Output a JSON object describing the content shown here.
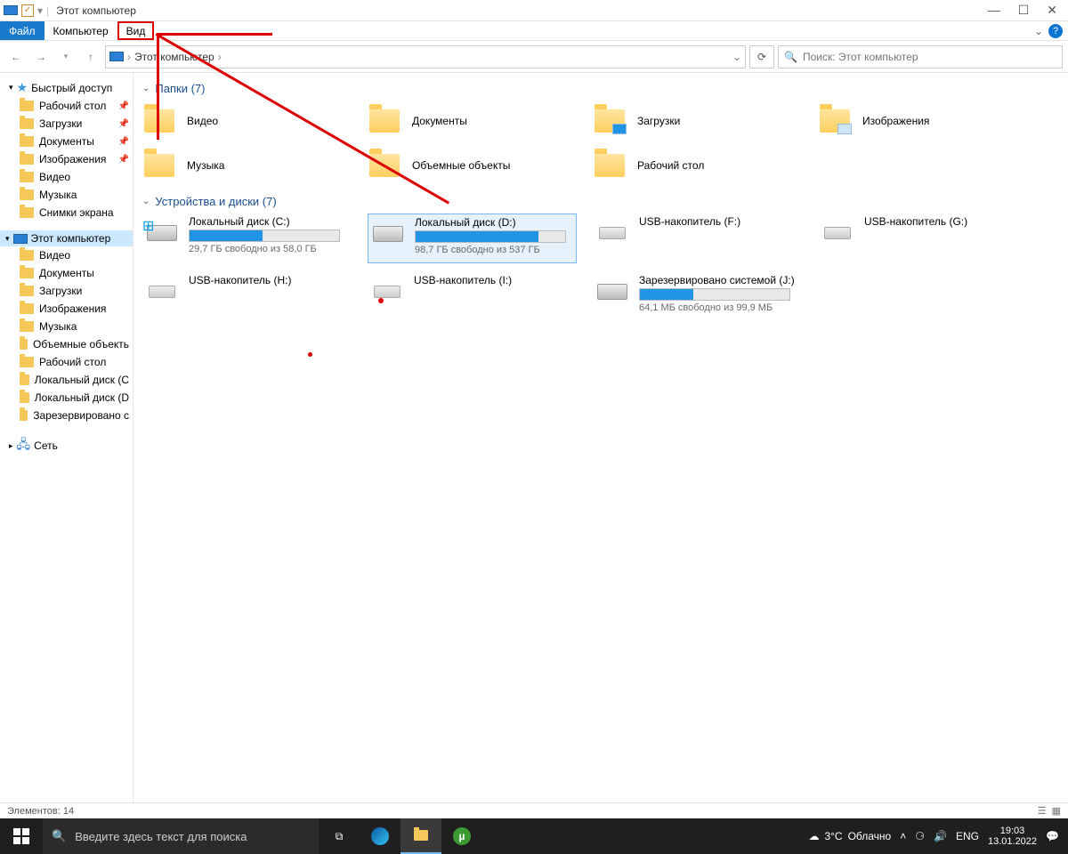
{
  "window": {
    "title": "Этот компьютер"
  },
  "ribbon": {
    "file": "Файл",
    "computer": "Компьютер",
    "view": "Вид"
  },
  "nav": {
    "breadcrumb_root": "Этот компьютер",
    "search_placeholder": "Поиск: Этот компьютер"
  },
  "sidebar": {
    "quick_access": "Быстрый доступ",
    "items_pinned": [
      {
        "label": "Рабочий стол"
      },
      {
        "label": "Загрузки"
      },
      {
        "label": "Документы"
      },
      {
        "label": "Изображения"
      },
      {
        "label": "Видео"
      },
      {
        "label": "Музыка"
      },
      {
        "label": "Снимки экрана"
      }
    ],
    "this_pc": "Этот компьютер",
    "this_pc_children": [
      {
        "label": "Видео"
      },
      {
        "label": "Документы"
      },
      {
        "label": "Загрузки"
      },
      {
        "label": "Изображения"
      },
      {
        "label": "Музыка"
      },
      {
        "label": "Объемные объекть"
      },
      {
        "label": "Рабочий стол"
      },
      {
        "label": "Локальный диск (С"
      },
      {
        "label": "Локальный диск (D"
      },
      {
        "label": "Зарезервировано с"
      }
    ],
    "network": "Сеть"
  },
  "groups": {
    "folders_header": "Папки (7)",
    "drives_header": "Устройства и диски (7)"
  },
  "folders": [
    {
      "label": "Видео"
    },
    {
      "label": "Документы"
    },
    {
      "label": "Загрузки"
    },
    {
      "label": "Изображения"
    },
    {
      "label": "Музыка"
    },
    {
      "label": "Объемные объекты"
    },
    {
      "label": "Рабочий стол"
    }
  ],
  "drives": [
    {
      "label": "Локальный диск (C:)",
      "free": "29,7 ГБ свободно из 58,0 ГБ",
      "fill": 49,
      "type": "hdd",
      "os": true
    },
    {
      "label": "Локальный диск (D:)",
      "free": "98,7 ГБ свободно из 537 ГБ",
      "fill": 82,
      "type": "hdd",
      "selected": true
    },
    {
      "label": "USB-накопитель (F:)",
      "free": "",
      "fill": 0,
      "type": "usb"
    },
    {
      "label": "USB-накопитель (G:)",
      "free": "",
      "fill": 0,
      "type": "usb"
    },
    {
      "label": "USB-накопитель (H:)",
      "free": "",
      "fill": 0,
      "type": "usb"
    },
    {
      "label": "USB-накопитель (I:)",
      "free": "",
      "fill": 0,
      "type": "usb",
      "red_dot": true
    },
    {
      "label": "Зарезервировано системой (J:)",
      "free": "64,1 МБ свободно из 99,9 МБ",
      "fill": 36,
      "type": "hdd"
    }
  ],
  "status": {
    "items": "Элементов: 14"
  },
  "taskbar": {
    "search_placeholder": "Введите здесь текст для поиска",
    "weather_temp": "3°C",
    "weather_desc": "Облачно",
    "lang": "ENG",
    "time": "19:03",
    "date": "13.01.2022"
  }
}
